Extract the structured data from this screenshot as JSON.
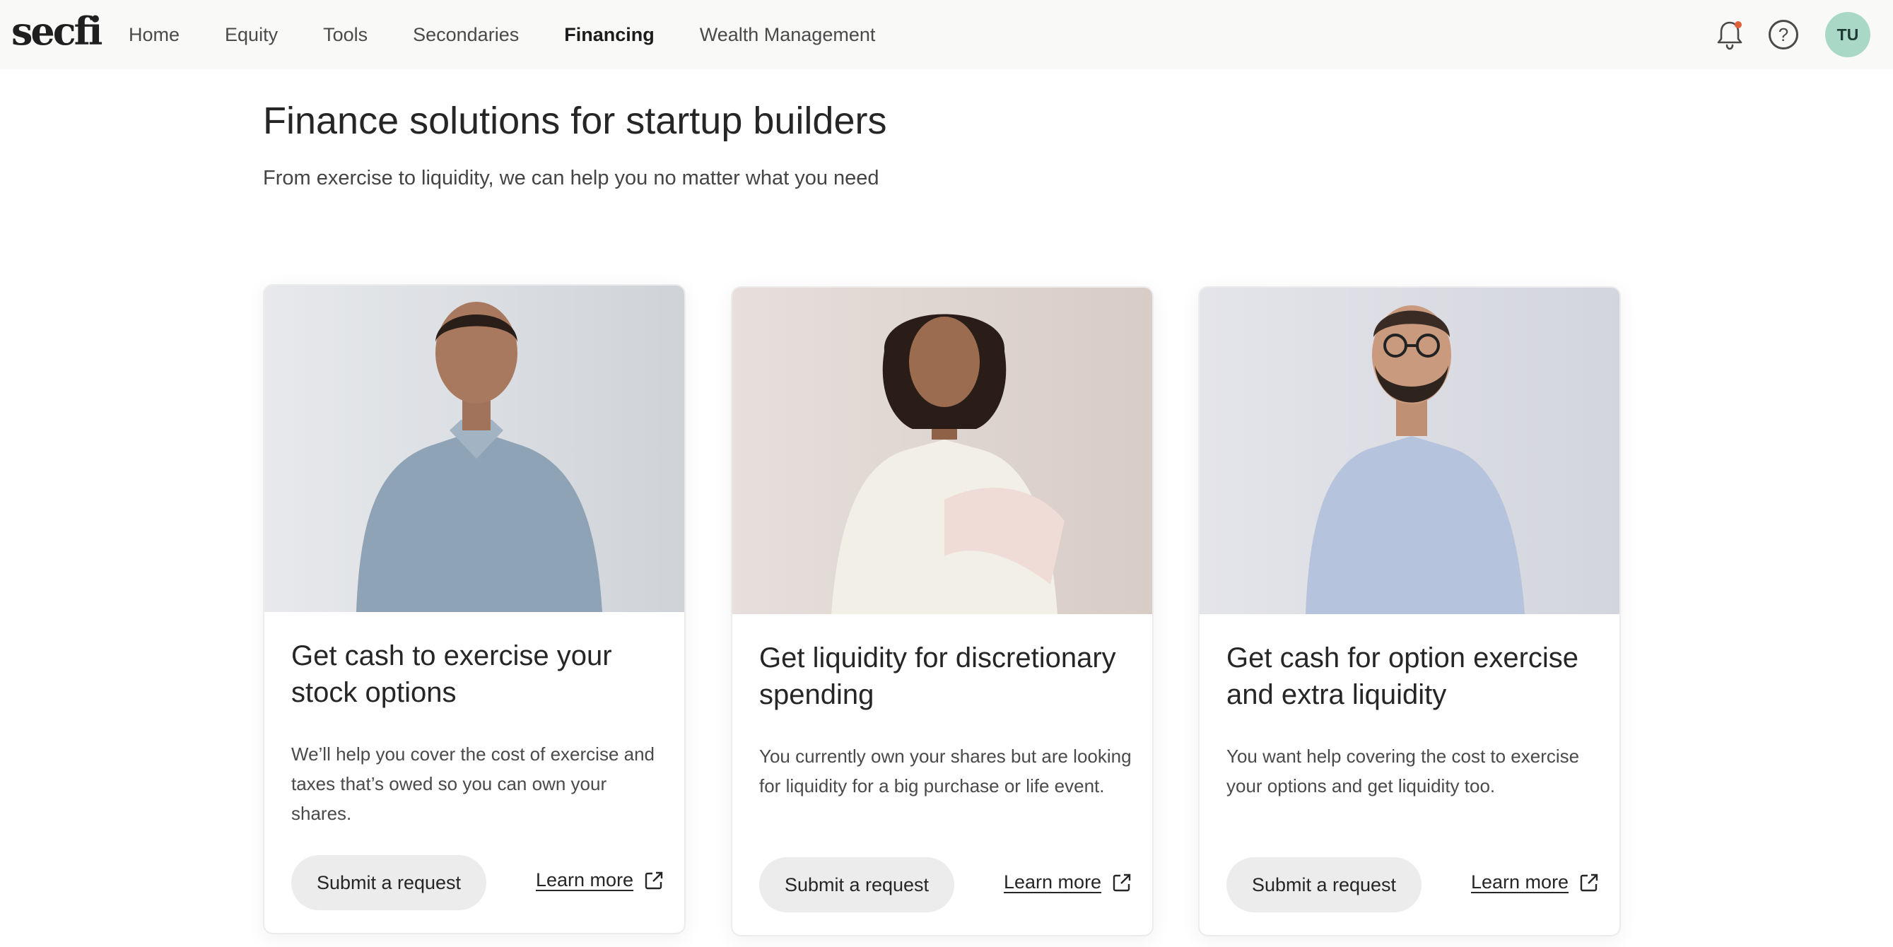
{
  "brand": {
    "logo_text": "secfi"
  },
  "nav": {
    "items": [
      {
        "label": "Home",
        "active": false
      },
      {
        "label": "Equity",
        "active": false
      },
      {
        "label": "Tools",
        "active": false
      },
      {
        "label": "Secondaries",
        "active": false
      },
      {
        "label": "Financing",
        "active": true
      },
      {
        "label": "Wealth Management",
        "active": false
      }
    ],
    "notification_icon": "bell-icon",
    "help_icon": "help-circle-icon",
    "avatar_initials": "TU"
  },
  "page": {
    "title": "Finance solutions for startup builders",
    "subtitle": "From exercise to liquidity, we can help you no matter what you need"
  },
  "cards": [
    {
      "title": "Get cash to exercise your stock options",
      "description": "We’ll help you cover the cost of exercise and taxes that’s owed so you can own your shares.",
      "button_label": "Submit a request",
      "link_label": "Learn more"
    },
    {
      "title": "Get liquidity for discretionary spending",
      "description": "You currently own your shares but are looking for liquidity for a big purchase or life event.",
      "button_label": "Submit a request",
      "link_label": "Learn more"
    },
    {
      "title": "Get cash for option exercise and extra liquidity",
      "description": "You want help covering the cost to exercise your options and get liquidity too.",
      "button_label": "Submit a request",
      "link_label": "Learn more"
    }
  ],
  "colors": {
    "nav_bg": "#f9f9f8",
    "avatar_bg": "#a9d9c6",
    "notification_dot": "#e0603a",
    "button_bg": "#ececec"
  }
}
